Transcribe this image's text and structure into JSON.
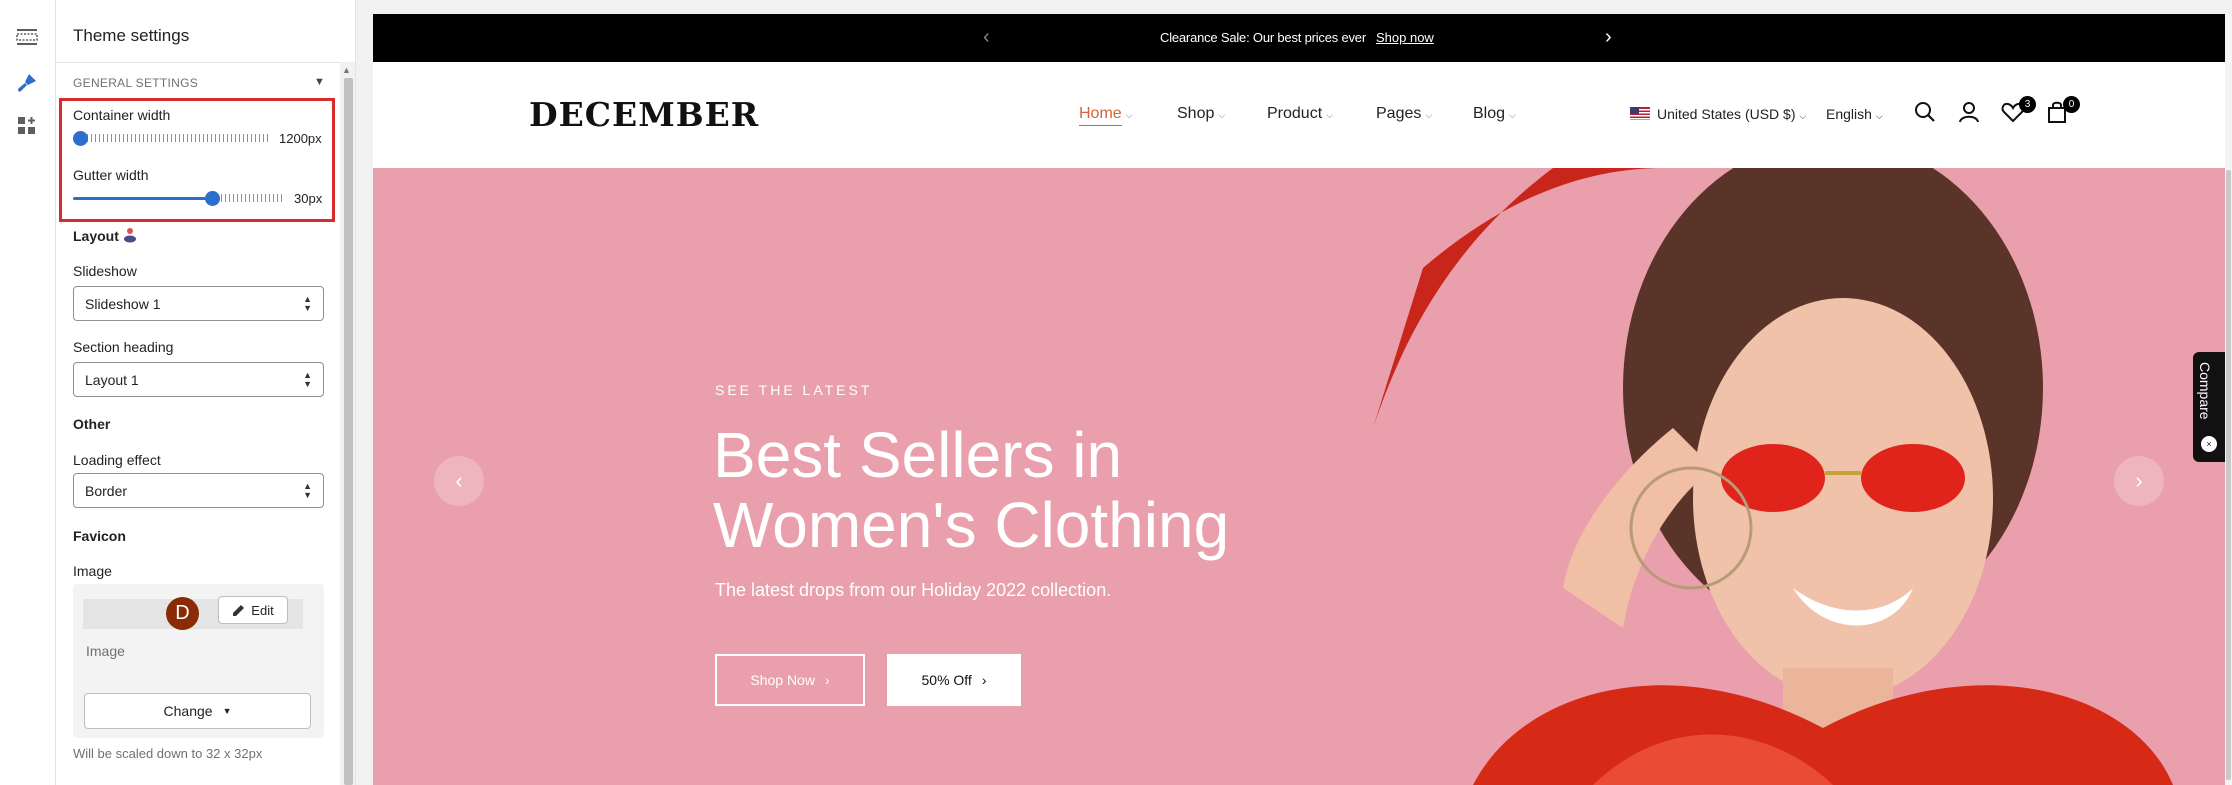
{
  "rail": {
    "icons": [
      "sections-icon",
      "theme-brush-icon",
      "app-blocks-icon"
    ]
  },
  "panel": {
    "title": "Theme settings",
    "section_caption": "GENERAL SETTINGS",
    "container_width": {
      "label": "Container width",
      "value": "1200px",
      "level": 0.0
    },
    "gutter_width": {
      "label": "Gutter width",
      "value": "30px",
      "level": 0.67
    },
    "layout": {
      "heading": "Layout",
      "slideshow_label": "Slideshow",
      "slideshow_value": "Slideshow 1",
      "section_heading_label": "Section heading",
      "section_heading_value": "Layout 1"
    },
    "other": {
      "heading": "Other",
      "loading_effect_label": "Loading effect",
      "loading_effect_value": "Border"
    },
    "favicon": {
      "heading": "Favicon",
      "image_label": "Image",
      "avatar_letter": "D",
      "edit_label": "Edit",
      "image_placeholder": "Image",
      "change_label": "Change",
      "hint": "Will be scaled down to 32 x 32px"
    }
  },
  "preview": {
    "announcement": {
      "text": "Clearance Sale: Our best prices ever",
      "link": "Shop now"
    },
    "logo": "DECEMBER",
    "nav": [
      "Home",
      "Shop",
      "Product",
      "Pages",
      "Blog"
    ],
    "currency": "United States (USD $)",
    "language": "English",
    "wishlist_count": "3",
    "cart_count": "0",
    "hero": {
      "kicker": "SEE THE LATEST",
      "title": "Best Sellers in Women's Clothing",
      "subtitle": "The latest drops from our Holiday 2022 collection.",
      "btn_primary": "Shop Now",
      "btn_secondary": "50% Off"
    },
    "compare": "Compare",
    "colors": {
      "hero_bg": "#e9a0ac",
      "accent": "#d7623b",
      "slider": "#2c6ecb",
      "highlight": "#d82c2c"
    }
  }
}
